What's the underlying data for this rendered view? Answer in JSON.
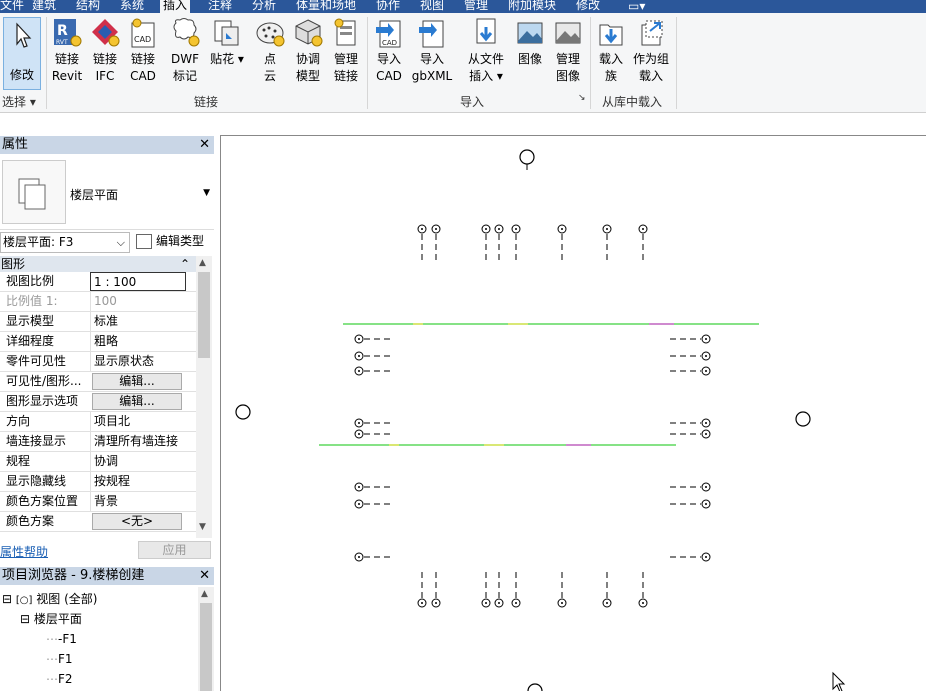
{
  "menu": {
    "tabs": [
      "文件",
      "建筑",
      "结构",
      "系统",
      "插入",
      "注释",
      "分析",
      "体量和场地",
      "协作",
      "视图",
      "管理",
      "附加模块",
      "修改"
    ],
    "active": "插入"
  },
  "ribbon": {
    "modify": {
      "label": "修改"
    },
    "select_group": {
      "label": "选择"
    },
    "link_buttons": [
      {
        "l1": "链接",
        "l2": "Revit"
      },
      {
        "l1": "链接",
        "l2": "IFC"
      },
      {
        "l1": "链接",
        "l2": "CAD"
      },
      {
        "l1": "DWF",
        "l2": "标记"
      },
      {
        "l1": "贴花",
        "l2": ""
      },
      {
        "l1": "点",
        "l2": "云"
      },
      {
        "l1": "协调",
        "l2": "模型"
      },
      {
        "l1": "管理",
        "l2": "链接"
      }
    ],
    "link_group": {
      "label": "链接"
    },
    "import_buttons": [
      {
        "l1": "导入",
        "l2": "CAD"
      },
      {
        "l1": "导入",
        "l2": "gbXML"
      },
      {
        "l1": "从文件",
        "l2": "插入"
      },
      {
        "l1": "图像",
        "l2": ""
      },
      {
        "l1": "管理",
        "l2": "图像"
      }
    ],
    "import_group": {
      "label": "导入"
    },
    "library_buttons": [
      {
        "l1": "载入",
        "l2": "族"
      },
      {
        "l1": "作为组",
        "l2": "载入"
      }
    ],
    "library_group": {
      "label": "从库中载入"
    }
  },
  "properties": {
    "title": "属性",
    "type_name": "楼层平面",
    "instance": "楼层平面: F3",
    "edit_type": "编辑类型",
    "category": "图形",
    "rows": [
      {
        "k": "视图比例",
        "v": "1 : 100"
      },
      {
        "k": "比例值 1:",
        "v": "100"
      },
      {
        "k": "显示模型",
        "v": "标准"
      },
      {
        "k": "详细程度",
        "v": "粗略"
      },
      {
        "k": "零件可见性",
        "v": "显示原状态"
      },
      {
        "k": "可见性/图形...",
        "v": "编辑..."
      },
      {
        "k": "图形显示选项",
        "v": "编辑..."
      },
      {
        "k": "方向",
        "v": "项目北"
      },
      {
        "k": "墙连接显示",
        "v": "清理所有墙连接"
      },
      {
        "k": "规程",
        "v": "协调"
      },
      {
        "k": "显示隐藏线",
        "v": "按规程"
      },
      {
        "k": "颜色方案位置",
        "v": "背景"
      },
      {
        "k": "颜色方案",
        "v": "<无>"
      }
    ],
    "help": "属性帮助",
    "apply": "应用"
  },
  "browser": {
    "title": "项目浏览器 - 9.楼梯创建",
    "tree": [
      "视图 (全部)",
      "楼层平面",
      "-F1",
      "F1",
      "F2"
    ]
  },
  "colors": {
    "accent": "#2b579a",
    "green_line": "#3fd13f",
    "magenta_line": "#d04ad0",
    "yellow_line": "#e0e040"
  }
}
